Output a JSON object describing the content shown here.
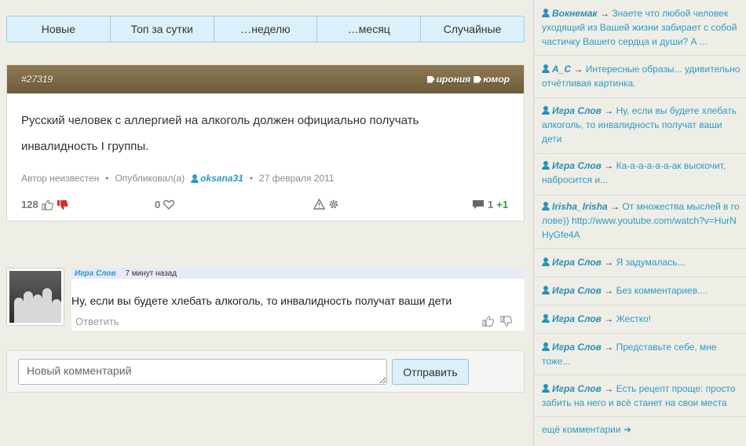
{
  "tabs": [
    "Новые",
    "Топ за сутки",
    "…неделю",
    "…месяц",
    "Случайные"
  ],
  "quote": {
    "id": "#27319",
    "tags": [
      "ирония",
      "юмор"
    ],
    "text_line1": "Русский человек с аллергией на алкоголь должен официально получать",
    "text_line2": "инвалидность I группы.",
    "author_label": "Автор неизвестен",
    "published_label": "Опубликовал(а)",
    "publisher": "oksana31",
    "date": "27 февраля 2011",
    "rating": "128",
    "favorites": "0",
    "comments_count": "1",
    "comments_delta": "+1",
    "thumb_up_icon": "thumb-up-icon",
    "thumb_down_icon": "thumb-down-icon",
    "heart_icon": "heart-icon",
    "warning_icon": "warning-icon",
    "gear_icon": "gear-icon",
    "comment_icon": "comment-icon"
  },
  "comment": {
    "author": "Игра Слов",
    "time": "7 минут назад",
    "text": "Ну, если вы будете хлебать алкоголь, то инвалидность получат ваши дети",
    "reply_label": "Ответить"
  },
  "new_comment": {
    "placeholder": "Новый комментарий",
    "submit_label": "Отправить"
  },
  "sidebar": {
    "items": [
      {
        "user": "Вокнемак",
        "text": "Знаете что любой человек уходящий из Вашей жизни забирает с собой частичку Вашего сердца и души? А ..."
      },
      {
        "user": "A_C",
        "text": "Интересные образы... удивительно отчётливая картинка."
      },
      {
        "user": "Игра Слов",
        "text": "Ну, если вы будете хлебать алкоголь, то инвалидность получат ваши дети"
      },
      {
        "user": "Игра Слов",
        "text": "Ка-а-а-а-а-а-ак выскочит, набросится и..."
      },
      {
        "user": "Irisha_Irisha",
        "text": "От множества мыслей в голове)) http://www.youtube.com/watch?v=HurNHyGfe4A"
      },
      {
        "user": "Игра Слов",
        "text": "Я задумалась..."
      },
      {
        "user": "Игра Слов",
        "text": "Без комментариев...."
      },
      {
        "user": "Игра Слов",
        "text": "Жестко!"
      },
      {
        "user": "Игра Слов",
        "text": "Представьте себе, мне тоже..."
      },
      {
        "user": "Игра Слов",
        "text": "Есть рецепт проще: просто забить на него и всё станет на свои места"
      }
    ],
    "arrow": "→",
    "more_label": "ещё комментарии ➔"
  }
}
